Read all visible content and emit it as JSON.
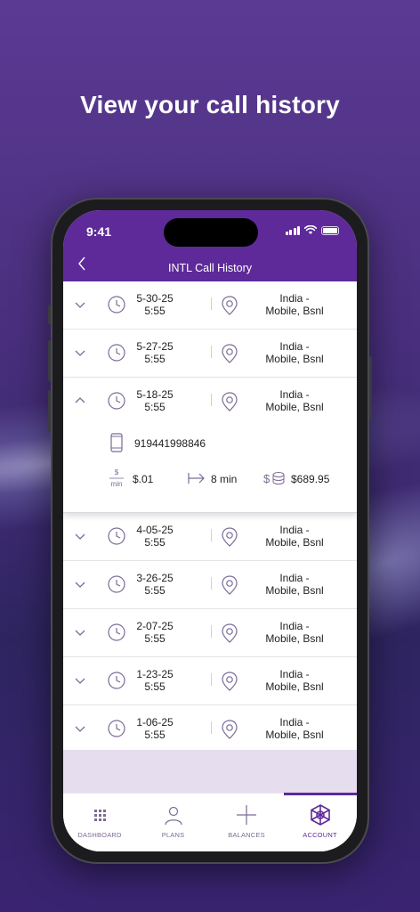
{
  "headline": "View your call history",
  "status_bar": {
    "time": "9:41"
  },
  "header": {
    "title": "INTL Call History"
  },
  "calls": [
    {
      "date": "5-30-25",
      "time": "5:55",
      "dest_line1": "India -",
      "dest_line2": "Mobile, Bsnl",
      "expanded": false
    },
    {
      "date": "5-27-25",
      "time": "5:55",
      "dest_line1": "India -",
      "dest_line2": "Mobile, Bsnl",
      "expanded": false
    },
    {
      "date": "5-18-25",
      "time": "5:55",
      "dest_line1": "India -",
      "dest_line2": "Mobile, Bsnl",
      "expanded": true
    },
    {
      "date": "4-05-25",
      "time": "5:55",
      "dest_line1": "India -",
      "dest_line2": "Mobile, Bsnl",
      "expanded": false
    },
    {
      "date": "3-26-25",
      "time": "5:55",
      "dest_line1": "India -",
      "dest_line2": "Mobile, Bsnl",
      "expanded": false
    },
    {
      "date": "2-07-25",
      "time": "5:55",
      "dest_line1": "India -",
      "dest_line2": "Mobile, Bsnl",
      "expanded": false
    },
    {
      "date": "1-23-25",
      "time": "5:55",
      "dest_line1": "India -",
      "dest_line2": "Mobile, Bsnl",
      "expanded": false
    },
    {
      "date": "1-06-25",
      "time": "5:55",
      "dest_line1": "India -",
      "dest_line2": "Mobile, Bsnl",
      "expanded": false
    }
  ],
  "detail": {
    "number": "919441998846",
    "rate": "$.01",
    "duration": "8 min",
    "balance": "$689.95",
    "rate_icon_top": "$",
    "rate_icon_bottom": "min"
  },
  "tabs": [
    {
      "label": "DASHBOARD",
      "icon": "grid-icon",
      "active": false
    },
    {
      "label": "PLANS",
      "icon": "person-icon",
      "active": false
    },
    {
      "label": "BALANCES",
      "icon": "plus-icon",
      "active": false
    },
    {
      "label": "ACCOUNT",
      "icon": "account-logo-icon",
      "active": true
    }
  ],
  "colors": {
    "brand": "#5e2a9a",
    "icon": "#7b6b96",
    "footer_band": "#e6ddef"
  }
}
